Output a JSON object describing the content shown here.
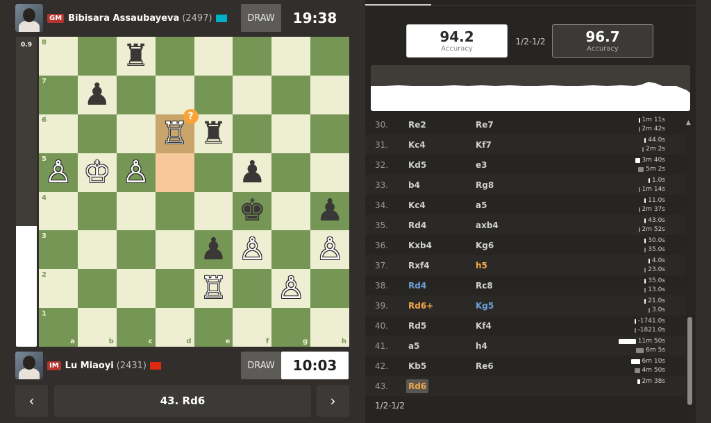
{
  "top_player": {
    "title": "GM",
    "name": "Bibisara Assaubayeva",
    "rating": "(2497)",
    "flag": "kz-flag",
    "draw_label": "DRAW",
    "clock": "19:38"
  },
  "bottom_player": {
    "title": "IM",
    "name": "Lu Miaoyi",
    "rating": "(2431)",
    "flag": "cn-flag",
    "draw_label": "DRAW",
    "clock": "10:03"
  },
  "eval": {
    "label": "0.9",
    "white_fraction": 0.39
  },
  "board": {
    "ranks": [
      "8",
      "7",
      "6",
      "5",
      "4",
      "3",
      "2",
      "1"
    ],
    "files": [
      "a",
      "b",
      "c",
      "d",
      "e",
      "f",
      "g",
      "h"
    ],
    "pieces": {
      "c8": "bR",
      "b7": "bP",
      "d6": "wR",
      "e6": "bR",
      "a5": "wP",
      "b5": "wK",
      "c5": "wP",
      "f5": "bP",
      "f4": "bK",
      "h4": "bP",
      "e3": "bP",
      "f3": "wP",
      "h3": "wP",
      "e2": "wR",
      "g2": "wP"
    },
    "highlight_from": "d5",
    "highlight_to": "d6",
    "annotation_square": "d6",
    "annotation_symbol": "?"
  },
  "nav": {
    "prev": "‹",
    "current_move": "43. Rd6",
    "next": "›"
  },
  "accuracy": {
    "white_value": "94.2",
    "white_label": "Accuracy",
    "black_value": "96.7",
    "black_label": "Accuracy",
    "result": "1/2-1/2"
  },
  "moves": [
    {
      "num": "30.",
      "white": "Re2",
      "black": "Re7",
      "wtime": "1m 11s",
      "btime": "2m 42s",
      "wbar": 0.02,
      "bbar": 0.02
    },
    {
      "num": "31.",
      "white": "Kc4",
      "black": "Kf7",
      "wtime": "44.0s",
      "btime": "2m 2s",
      "wbar": 0.02,
      "bbar": 0.02
    },
    {
      "num": "32.",
      "white": "Kd5",
      "black": "e3",
      "wtime": "3m 40s",
      "btime": "5m 2s",
      "wbar": 0.1,
      "bbar": 0.12
    },
    {
      "num": "33.",
      "white": "b4",
      "black": "Rg8",
      "wtime": "1.0s",
      "btime": "1m 14s",
      "wbar": 0.02,
      "bbar": 0.02
    },
    {
      "num": "34.",
      "white": "Kc4",
      "black": "a5",
      "wtime": "11.0s",
      "btime": "2m 37s",
      "wbar": 0.02,
      "bbar": 0.02
    },
    {
      "num": "35.",
      "white": "Rd4",
      "black": "axb4",
      "wtime": "43.0s",
      "btime": "2m 52s",
      "wbar": 0.02,
      "bbar": 0.02
    },
    {
      "num": "36.",
      "white": "Kxb4",
      "black": "Kg6",
      "wtime": "30.0s",
      "btime": "35.0s",
      "wbar": 0.02,
      "bbar": 0.02
    },
    {
      "num": "37.",
      "white": "Rxf4",
      "black": "h5",
      "black_class": "orange",
      "wtime": "4.0s",
      "btime": "23.0s",
      "wbar": 0.02,
      "bbar": 0.02
    },
    {
      "num": "38.",
      "white": "Rd4",
      "white_class": "blue",
      "black": "Rc8",
      "wtime": "35.0s",
      "btime": "13.0s",
      "wbar": 0.02,
      "bbar": 0.02
    },
    {
      "num": "39.",
      "white": "Rd6+",
      "white_class": "orange",
      "black": "Kg5",
      "black_class": "blue",
      "wtime": "21.0s",
      "btime": "3.0s",
      "wbar": 0.02,
      "bbar": 0.02
    },
    {
      "num": "40.",
      "white": "Rd5",
      "black": "Kf4",
      "wtime": "-1741.0s",
      "btime": "-1821.0s",
      "wbar": 0.02,
      "bbar": 0.02
    },
    {
      "num": "41.",
      "white": "a5",
      "black": "h4",
      "wtime": "11m 50s",
      "btime": "6m 5s",
      "wbar": 0.35,
      "bbar": 0.15
    },
    {
      "num": "42.",
      "white": "Kb5",
      "black": "Re6",
      "wtime": "6m 10s",
      "btime": "4m 50s",
      "wbar": 0.18,
      "bbar": 0.12
    },
    {
      "num": "43.",
      "white": "Rd6",
      "white_class": "current",
      "black": "",
      "wtime": "2m 38s",
      "btime": "",
      "wbar": 0.05,
      "bbar": 0
    }
  ],
  "final_result": "1/2-1/2",
  "colors": {
    "light_square": "#eeeed2",
    "dark_square": "#769656",
    "background": "#312e2b",
    "panel": "#272522",
    "title_badge": "#b33430",
    "accent_orange": "#f7a53b",
    "accent_blue": "#6e9ed8"
  }
}
